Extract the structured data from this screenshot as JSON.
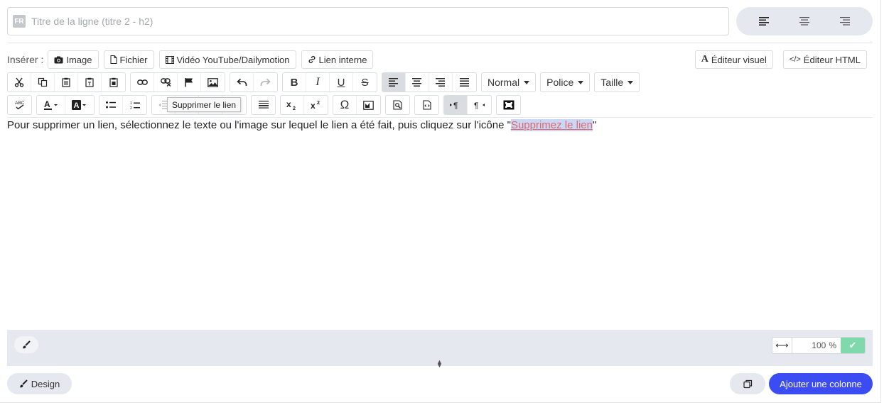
{
  "title_field": {
    "lang": "FR",
    "placeholder": "Titre de la ligne (titre 2 - h2)"
  },
  "align_buttons": [
    "align-left-icon",
    "align-center-icon",
    "align-right-icon"
  ],
  "insert": {
    "label": "Insérer :",
    "buttons": [
      {
        "icon": "camera-icon",
        "label": "Image"
      },
      {
        "icon": "file-icon",
        "label": "Fichier"
      },
      {
        "icon": "film-icon",
        "label": "Vidéo YouTube/Dailymotion"
      },
      {
        "icon": "link-icon",
        "label": "Lien interne"
      }
    ]
  },
  "editor_modes": {
    "visual": "Éditeur visuel",
    "html": "Éditeur HTML"
  },
  "toolbar": {
    "format_label": "Normal",
    "font_label": "Police",
    "size_label": "Taille"
  },
  "tooltip": "Supprimer le lien",
  "content": {
    "text_before": "Pour supprimer un lien, sélectionnez le texte ou l'image sur lequel le lien a été fait, puis cliquez sur l'icône \"",
    "link_text": "Supprimez le lien",
    "text_after": "\""
  },
  "footer": {
    "width_value": "100",
    "width_unit": "%"
  },
  "bottom": {
    "design_label": "Design",
    "add_column_label": "Ajouter une colonne"
  },
  "colors": {
    "accent": "#3b4cf2",
    "link": "#e6636d",
    "confirm": "#7fd9ad"
  }
}
